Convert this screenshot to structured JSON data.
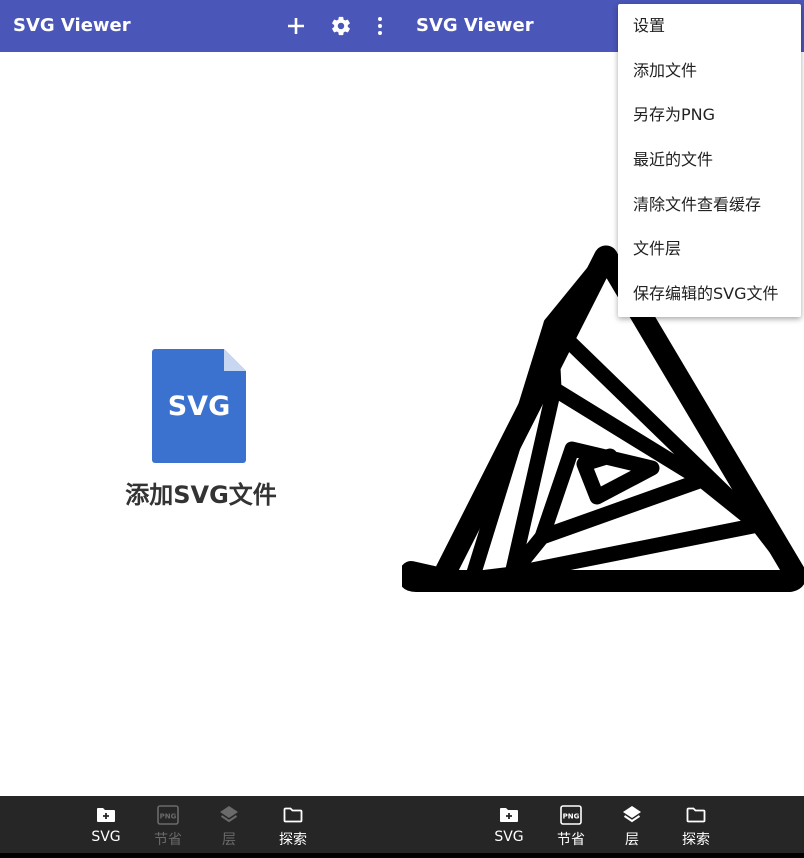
{
  "colors": {
    "appbar": "#4a56b8",
    "bottombar": "#262626",
    "file_icon": "#3b72d0"
  },
  "left": {
    "title": "SVG Viewer",
    "icons": [
      "add-icon",
      "gear-icon",
      "more-vert-icon"
    ],
    "add_file": {
      "icon_text": "SVG",
      "label": "添加SVG文件"
    },
    "bottom_nav": [
      {
        "label": "SVG",
        "icon": "add-folder-icon",
        "enabled": true
      },
      {
        "label": "节省",
        "icon": "png-icon",
        "enabled": false
      },
      {
        "label": "层",
        "icon": "layers-icon",
        "enabled": false
      },
      {
        "label": "探索",
        "icon": "folder-icon",
        "enabled": true
      }
    ]
  },
  "right": {
    "title": "SVG Viewer",
    "bottom_nav": [
      {
        "label": "SVG",
        "icon": "add-folder-icon",
        "enabled": true
      },
      {
        "label": "节省",
        "icon": "png-icon",
        "enabled": true
      },
      {
        "label": "层",
        "icon": "layers-icon",
        "enabled": true
      },
      {
        "label": "探索",
        "icon": "folder-icon",
        "enabled": true
      }
    ],
    "png_icon_text": "PNG"
  },
  "menu": {
    "items": [
      "设置",
      "添加文件",
      "另存为PNG",
      "最近的文件",
      "清除文件查看缓存",
      "文件层",
      "保存编辑的SVG文件"
    ]
  }
}
